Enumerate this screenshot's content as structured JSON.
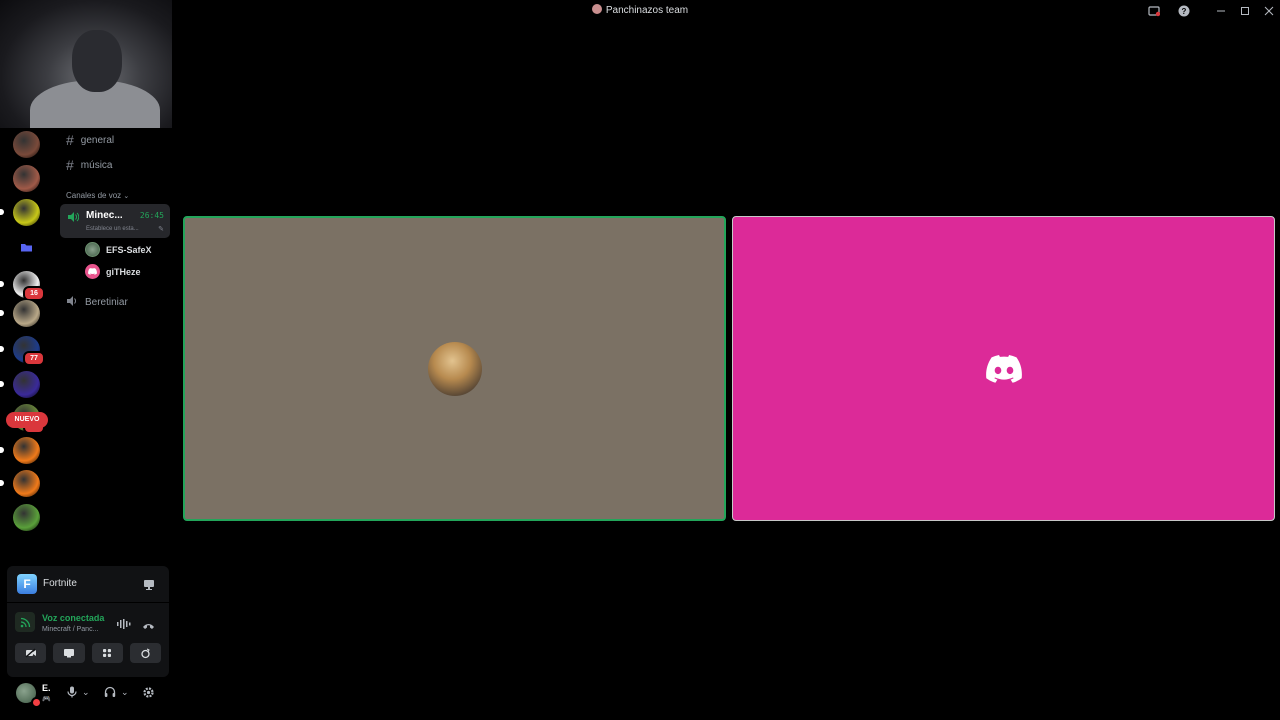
{
  "window": {
    "title": "Panchinazos team"
  },
  "titlebar_icons": [
    "inbox-icon",
    "help-icon",
    "minimize-icon",
    "maximize-icon",
    "close-icon"
  ],
  "servers": [
    {
      "name": "server-1",
      "color": "#7a4a3a",
      "badge": ""
    },
    {
      "name": "server-2",
      "color": "#a05a48",
      "badge": ""
    },
    {
      "name": "server-3",
      "color": "#c8c818",
      "badge": ""
    },
    {
      "name": "folder",
      "color": "#5865f2",
      "badge": ""
    },
    {
      "name": "server-5",
      "color": "#eeeeee",
      "badge": "16"
    },
    {
      "name": "server-6",
      "color": "#b9a888",
      "badge": ""
    },
    {
      "name": "server-7",
      "color": "#1d3b8a",
      "badge": "77"
    },
    {
      "name": "server-8",
      "color": "#3a2a9a",
      "badge": ""
    },
    {
      "name": "server-9",
      "color": "#6b8a3a",
      "badge": "1"
    },
    {
      "name": "server-10",
      "color": "#f07a1a",
      "badge": ""
    },
    {
      "name": "server-11",
      "color": "#f07a1a",
      "badge": ""
    },
    {
      "name": "server-12",
      "color": "#5aa03a",
      "badge": ""
    }
  ],
  "new_label": "NUEVO",
  "channels": {
    "text": [
      {
        "name": "general"
      },
      {
        "name": "música"
      }
    ],
    "voice_category": "Canales de voz",
    "active_voice": {
      "name": "Minec...",
      "timer": "26:45",
      "status": "Establece un esta..."
    },
    "users": [
      {
        "name": "EFS-SafeX",
        "color": "#6b8f6e"
      },
      {
        "name": "giTHeze",
        "color": "#e8548d"
      }
    ],
    "other_voice": {
      "name": "Beretiniar"
    }
  },
  "activity": {
    "game": "Fortnite",
    "game_icon_letter": "F"
  },
  "voice_panel": {
    "status": "Voz conectada",
    "channel": "Minecraft / Panc..."
  },
  "user_panel": {
    "name": "E.",
    "activity": "🎮"
  },
  "colors": {
    "accent_green": "#23a55a",
    "tile_left": "#7b7164",
    "tile_right": "#dc2a98",
    "danger": "#da373c"
  }
}
